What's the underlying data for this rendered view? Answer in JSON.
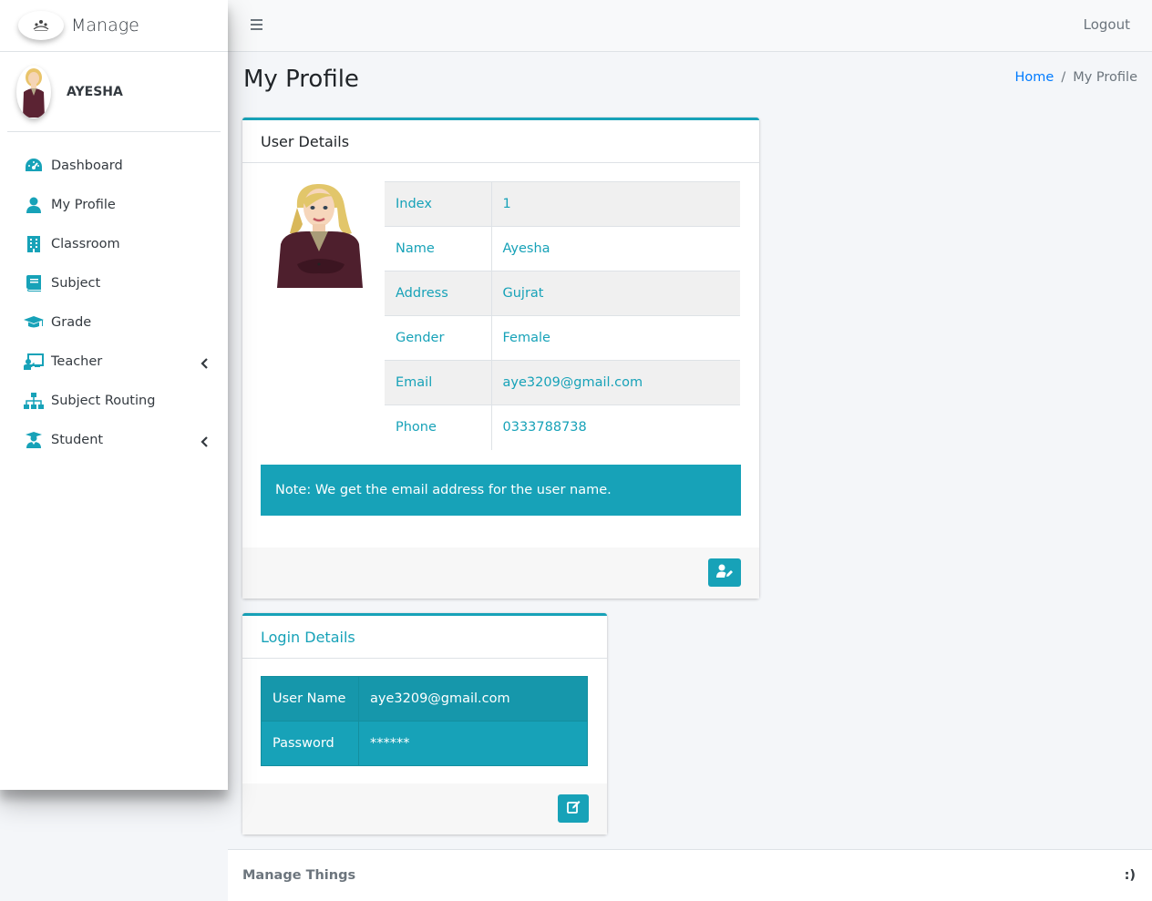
{
  "brand": {
    "title": "Manage"
  },
  "user": {
    "name": "AYESHA"
  },
  "sidebar": {
    "items": [
      {
        "label": "Dashboard"
      },
      {
        "label": "My Profile"
      },
      {
        "label": "Classroom"
      },
      {
        "label": "Subject"
      },
      {
        "label": "Grade"
      },
      {
        "label": "Teacher"
      },
      {
        "label": "Subject Routing"
      },
      {
        "label": "Student"
      }
    ]
  },
  "topbar": {
    "logout": "Logout"
  },
  "header": {
    "title": "My Profile",
    "breadcrumb_home": "Home",
    "breadcrumb_sep": "/",
    "breadcrumb_current": "My Profile"
  },
  "user_details": {
    "title": "User Details",
    "rows": [
      {
        "label": "Index",
        "value": "1"
      },
      {
        "label": "Name",
        "value": "Ayesha"
      },
      {
        "label": "Address",
        "value": "Gujrat"
      },
      {
        "label": "Gender",
        "value": "Female"
      },
      {
        "label": "Email",
        "value": "aye3209@gmail.com"
      },
      {
        "label": "Phone",
        "value": "0333788738"
      }
    ],
    "note": "Note: We get the email address for the user name."
  },
  "login_details": {
    "title": "Login Details",
    "rows": [
      {
        "label": "User Name",
        "value": "aye3209@gmail.com"
      },
      {
        "label": "Password",
        "value": "******"
      }
    ]
  },
  "footer": {
    "left": "Manage Things",
    "right": ":)"
  },
  "colors": {
    "accent": "#17a2b8",
    "link": "#007bff"
  }
}
